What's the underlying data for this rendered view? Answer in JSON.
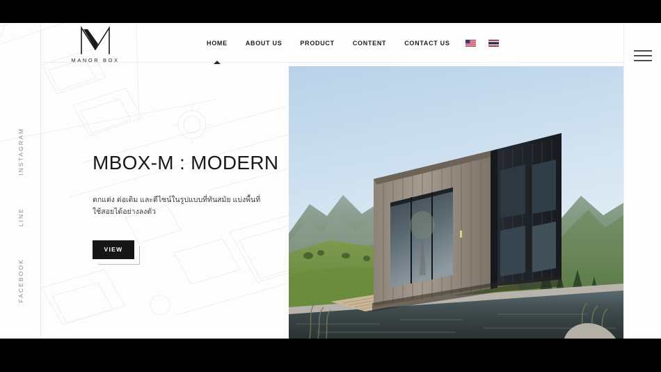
{
  "brand": {
    "logo_mark": "M",
    "logo_word": "MANOR BOX"
  },
  "nav": {
    "items": [
      {
        "label": "HOME",
        "active": true
      },
      {
        "label": "ABOUT US",
        "active": false
      },
      {
        "label": "PRODUCT",
        "active": false
      },
      {
        "label": "CONTENT",
        "active": false
      },
      {
        "label": "CONTACT US",
        "active": false
      }
    ],
    "languages": [
      {
        "name": "flag-us-icon",
        "title": "English"
      },
      {
        "name": "flag-th-icon",
        "title": "Thai"
      }
    ],
    "menu_icon": "hamburger-menu-icon"
  },
  "social_rail": {
    "items": [
      "INSTAGRAM",
      "LINE",
      "FACEBOOK"
    ]
  },
  "hero": {
    "title": "MBOX-M : MODERN",
    "subtitle": "ตกแต่ง ต่อเติม และดีไซน์ในรูปแบบที่ทันสมัย แบ่งพื้นที่ใช้สอยได้อย่างลงตัว",
    "cta_label": "VIEW",
    "image_alt": "modern-cubic-house-mountain-pool"
  },
  "carousel": {
    "prev_icon": "chevron-left-icon",
    "prev_glyph": "❮",
    "next_icon": "chevron-right-icon",
    "next_glyph": "❯"
  },
  "colors": {
    "page_bg": "#fdfdfd",
    "letterbox": "#000000",
    "text_dark": "#1a1a1a",
    "text_muted": "#8c8c8c",
    "button_bg": "#161616",
    "divider": "#ececec"
  }
}
